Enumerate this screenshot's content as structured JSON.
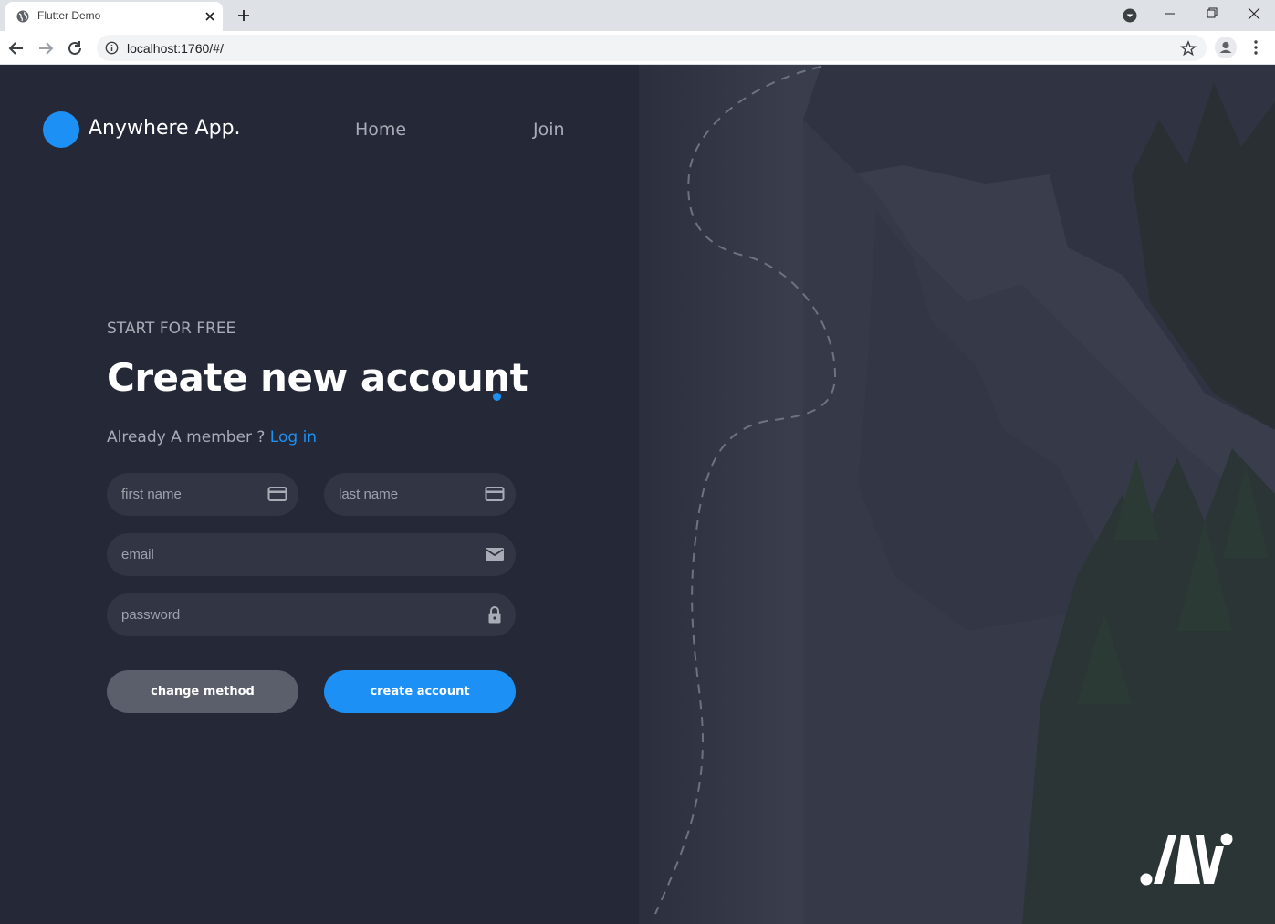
{
  "browser": {
    "tab_title": "Flutter Demo",
    "url": "localhost:1760/#/"
  },
  "header": {
    "brand": "Anywhere App.",
    "nav": [
      {
        "label": "Home"
      },
      {
        "label": "Join"
      }
    ]
  },
  "form": {
    "eyebrow": "START FOR FREE",
    "title": "Create new account",
    "member_prompt": "Already A member ? ",
    "login_link": "Log in",
    "fields": {
      "first_name": {
        "placeholder": "first name",
        "icon": "card-icon"
      },
      "last_name": {
        "placeholder": "last name",
        "icon": "card-icon"
      },
      "email": {
        "placeholder": "email",
        "icon": "mail-icon"
      },
      "password": {
        "placeholder": "password",
        "icon": "lock-icon"
      }
    },
    "buttons": {
      "change_method": "change method",
      "create_account": "create account"
    }
  },
  "colors": {
    "accent": "#1d90f5",
    "background": "#252836",
    "field": "#323644",
    "secondary_button": "#5b5f6b"
  }
}
